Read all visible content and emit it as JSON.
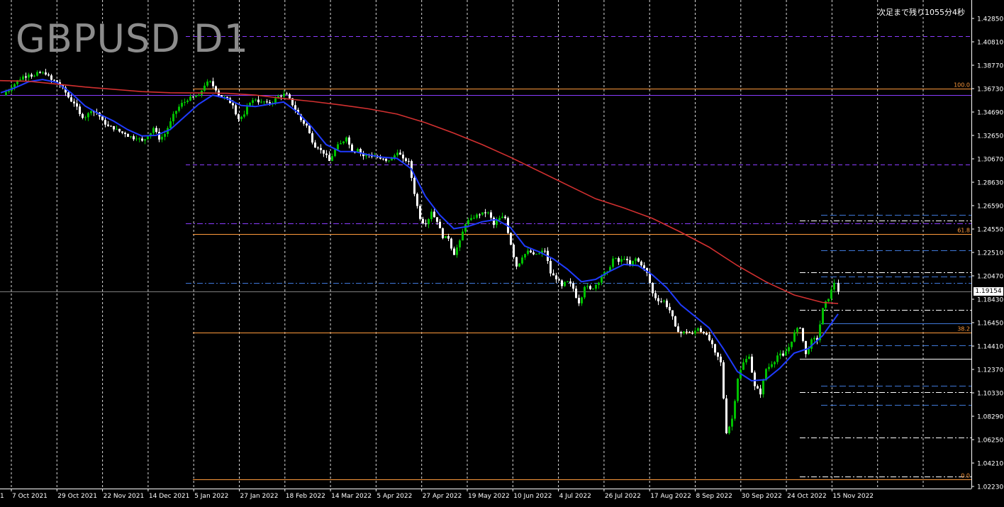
{
  "symbol_title": "GBPUSD D1",
  "countdown": "次足まで残り1055分4秒",
  "current_price_label": "1.19154",
  "colors": {
    "background": "#000000",
    "bull_candle": "#00c000",
    "bear_candle": "#ffffff",
    "ma_fast": "#1f3bff",
    "ma_slow": "#d23030",
    "fib_lines": "#ff9a3c",
    "purple_levels": "#8a3cff",
    "blue_levels": "#3f78d8",
    "grid": "#ffffff",
    "axis_text": "#ffffff"
  },
  "chart_data": {
    "type": "candlestick",
    "y_axis": {
      "range": [
        1.0182,
        1.4366
      ],
      "ticks": [
        "1.42850",
        "1.40810",
        "1.38770",
        "1.36730",
        "1.34690",
        "1.32650",
        "1.30670",
        "1.28630",
        "1.26590",
        "1.24550",
        "1.22510",
        "1.20470",
        "1.18430",
        "1.16450",
        "1.14410",
        "1.12370",
        "1.10330",
        "1.08290",
        "1.06250",
        "1.04210",
        "1.02230"
      ]
    },
    "x_axis": {
      "labels": [
        "7 Oct 2021",
        "29 Oct 2021",
        "22 Nov 2021",
        "14 Dec 2021",
        "5 Jan 2022",
        "27 Jan 2022",
        "18 Feb 2022",
        "14 Mar 2022",
        "5 Apr 2022",
        "27 Apr 2022",
        "19 May 2022",
        "10 Jun 2022",
        "4 Jul 2022",
        "26 Jul 2022",
        "17 Aug 2022",
        "8 Sep 2022",
        "30 Sep 2022",
        "24 Oct 2022",
        "15 Nov 2022"
      ],
      "first_partial_label": "1"
    },
    "series": [
      {
        "kind": "close",
        "points": [
          [
            1,
            1.3618
          ],
          [
            8,
            1.3648
          ],
          [
            16,
            1.3688
          ],
          [
            24,
            1.3748
          ],
          [
            32,
            1.3782
          ],
          [
            40,
            1.3798
          ],
          [
            48,
            1.3788
          ],
          [
            56,
            1.3812
          ],
          [
            64,
            1.3798
          ],
          [
            72,
            1.3752
          ],
          [
            80,
            1.3731
          ],
          [
            88,
            1.3685
          ],
          [
            96,
            1.36
          ],
          [
            104,
            1.3548
          ],
          [
            112,
            1.3455
          ],
          [
            120,
            1.3427
          ],
          [
            128,
            1.348
          ],
          [
            136,
            1.3468
          ],
          [
            144,
            1.3403
          ],
          [
            152,
            1.3352
          ],
          [
            160,
            1.3322
          ],
          [
            168,
            1.3304
          ],
          [
            176,
            1.3282
          ],
          [
            184,
            1.3262
          ],
          [
            192,
            1.3242
          ],
          [
            200,
            1.3224
          ],
          [
            208,
            1.3262
          ],
          [
            216,
            1.3334
          ],
          [
            224,
            1.3234
          ],
          [
            232,
            1.3282
          ],
          [
            240,
            1.3392
          ],
          [
            248,
            1.3482
          ],
          [
            256,
            1.3552
          ],
          [
            264,
            1.3572
          ],
          [
            272,
            1.3601
          ],
          [
            280,
            1.3622
          ],
          [
            288,
            1.3702
          ],
          [
            296,
            1.374
          ],
          [
            304,
            1.366
          ],
          [
            312,
            1.3598
          ],
          [
            320,
            1.3591
          ],
          [
            328,
            1.3531
          ],
          [
            336,
            1.3412
          ],
          [
            344,
            1.3452
          ],
          [
            352,
            1.3552
          ],
          [
            360,
            1.358
          ],
          [
            368,
            1.3562
          ],
          [
            376,
            1.3558
          ],
          [
            384,
            1.3552
          ],
          [
            392,
            1.3612
          ],
          [
            400,
            1.3632
          ],
          [
            408,
            1.3592
          ],
          [
            416,
            1.3492
          ],
          [
            424,
            1.3402
          ],
          [
            432,
            1.3356
          ],
          [
            440,
            1.3208
          ],
          [
            448,
            1.316
          ],
          [
            456,
            1.3112
          ],
          [
            464,
            1.3048
          ],
          [
            472,
            1.3148
          ],
          [
            480,
            1.3202
          ],
          [
            488,
            1.3252
          ],
          [
            496,
            1.3126
          ],
          [
            504,
            1.3152
          ],
          [
            512,
            1.309
          ],
          [
            520,
            1.3102
          ],
          [
            528,
            1.3089
          ],
          [
            536,
            1.3068
          ],
          [
            544,
            1.3049
          ],
          [
            552,
            1.3073
          ],
          [
            560,
            1.312
          ],
          [
            568,
            1.307
          ],
          [
            576,
            1.3047
          ],
          [
            584,
            1.2762
          ],
          [
            592,
            1.2545
          ],
          [
            600,
            1.2499
          ],
          [
            608,
            1.2608
          ],
          [
            616,
            1.252
          ],
          [
            624,
            1.2378
          ],
          [
            632,
            1.2374
          ],
          [
            640,
            1.2232
          ],
          [
            648,
            1.2358
          ],
          [
            656,
            1.2498
          ],
          [
            664,
            1.2552
          ],
          [
            672,
            1.2583
          ],
          [
            680,
            1.2602
          ],
          [
            688,
            1.2602
          ],
          [
            696,
            1.2493
          ],
          [
            704,
            1.2553
          ],
          [
            712,
            1.2553
          ],
          [
            720,
            1.2321
          ],
          [
            728,
            1.2132
          ],
          [
            736,
            1.221
          ],
          [
            744,
            1.227
          ],
          [
            752,
            1.2238
          ],
          [
            760,
            1.2246
          ],
          [
            768,
            1.2268
          ],
          [
            776,
            1.2072
          ],
          [
            784,
            1.2021
          ],
          [
            792,
            1.1962
          ],
          [
            800,
            1.2002
          ],
          [
            808,
            1.194
          ],
          [
            816,
            1.1812
          ],
          [
            824,
            1.1955
          ],
          [
            832,
            1.1937
          ],
          [
            840,
            1.1972
          ],
          [
            848,
            1.2051
          ],
          [
            856,
            1.209
          ],
          [
            864,
            1.2201
          ],
          [
            872,
            1.2173
          ],
          [
            880,
            1.2198
          ],
          [
            888,
            1.214
          ],
          [
            896,
            1.2202
          ],
          [
            904,
            1.2142
          ],
          [
            912,
            1.2078
          ],
          [
            920,
            1.19
          ],
          [
            928,
            1.183
          ],
          [
            936,
            1.1836
          ],
          [
            944,
            1.1752
          ],
          [
            952,
            1.1612
          ],
          [
            960,
            1.1552
          ],
          [
            968,
            1.1562
          ],
          [
            976,
            1.155
          ],
          [
            984,
            1.1596
          ],
          [
            992,
            1.1552
          ],
          [
            1000,
            1.1492
          ],
          [
            1008,
            1.1385
          ],
          [
            1016,
            1.13
          ],
          [
            1024,
            1.0685
          ],
          [
            1032,
            1.0811
          ],
          [
            1040,
            1.1158
          ],
          [
            1048,
            1.13
          ],
          [
            1056,
            1.135
          ],
          [
            1064,
            1.1093
          ],
          [
            1072,
            1.1022
          ],
          [
            1080,
            1.1242
          ],
          [
            1088,
            1.1284
          ],
          [
            1096,
            1.136
          ],
          [
            1104,
            1.1358
          ],
          [
            1112,
            1.1432
          ],
          [
            1120,
            1.1562
          ],
          [
            1128,
            1.1598
          ],
          [
            1136,
            1.1372
          ],
          [
            1144,
            1.15
          ],
          [
            1152,
            1.1492
          ],
          [
            1160,
            1.1772
          ],
          [
            1168,
            1.1852
          ],
          [
            1176,
            1.199
          ],
          [
            1182,
            1.1915
          ]
        ]
      },
      {
        "name": "",
        "kind": "moving-average-fast",
        "points": [
          [
            1,
            1.364
          ],
          [
            20,
            1.368
          ],
          [
            40,
            1.3735
          ],
          [
            60,
            1.3755
          ],
          [
            80,
            1.373
          ],
          [
            100,
            1.364
          ],
          [
            120,
            1.3525
          ],
          [
            140,
            1.3455
          ],
          [
            160,
            1.3395
          ],
          [
            180,
            1.332
          ],
          [
            200,
            1.3265
          ],
          [
            220,
            1.327
          ],
          [
            240,
            1.332
          ],
          [
            260,
            1.343
          ],
          [
            280,
            1.354
          ],
          [
            300,
            1.362
          ],
          [
            320,
            1.359
          ],
          [
            340,
            1.353
          ],
          [
            360,
            1.352
          ],
          [
            380,
            1.354
          ],
          [
            400,
            1.356
          ],
          [
            420,
            1.347
          ],
          [
            440,
            1.334
          ],
          [
            460,
            1.319
          ],
          [
            480,
            1.313
          ],
          [
            500,
            1.313
          ],
          [
            520,
            1.31
          ],
          [
            540,
            1.308
          ],
          [
            560,
            1.307
          ],
          [
            580,
            1.298
          ],
          [
            600,
            1.274
          ],
          [
            620,
            1.258
          ],
          [
            640,
            1.246
          ],
          [
            660,
            1.248
          ],
          [
            680,
            1.252
          ],
          [
            700,
            1.254
          ],
          [
            720,
            1.247
          ],
          [
            740,
            1.231
          ],
          [
            760,
            1.226
          ],
          [
            780,
            1.22
          ],
          [
            800,
            1.211
          ],
          [
            820,
            1.2
          ],
          [
            840,
            1.202
          ],
          [
            860,
            1.209
          ],
          [
            880,
            1.215
          ],
          [
            900,
            1.214
          ],
          [
            920,
            1.206
          ],
          [
            940,
            1.195
          ],
          [
            960,
            1.18
          ],
          [
            980,
            1.17
          ],
          [
            1000,
            1.16
          ],
          [
            1020,
            1.142
          ],
          [
            1040,
            1.122
          ],
          [
            1060,
            1.114
          ],
          [
            1080,
            1.115
          ],
          [
            1100,
            1.125
          ],
          [
            1120,
            1.138
          ],
          [
            1140,
            1.142
          ],
          [
            1160,
            1.153
          ],
          [
            1182,
            1.172
          ]
        ]
      },
      {
        "name": "",
        "kind": "moving-average-slow",
        "points": [
          [
            0,
            1.3745
          ],
          [
            40,
            1.374
          ],
          [
            80,
            1.3715
          ],
          [
            120,
            1.369
          ],
          [
            160,
            1.367
          ],
          [
            200,
            1.365
          ],
          [
            240,
            1.364
          ],
          [
            280,
            1.3638
          ],
          [
            320,
            1.3635
          ],
          [
            360,
            1.362
          ],
          [
            400,
            1.359
          ],
          [
            440,
            1.3565
          ],
          [
            480,
            1.3535
          ],
          [
            520,
            1.35
          ],
          [
            560,
            1.3455
          ],
          [
            600,
            1.338
          ],
          [
            640,
            1.329
          ],
          [
            680,
            1.319
          ],
          [
            720,
            1.308
          ],
          [
            760,
            1.296
          ],
          [
            800,
            1.284
          ],
          [
            840,
            1.272
          ],
          [
            880,
            1.264
          ],
          [
            920,
            1.255
          ],
          [
            960,
            1.243
          ],
          [
            1000,
            1.23
          ],
          [
            1040,
            1.214
          ],
          [
            1080,
            1.2
          ],
          [
            1120,
            1.1885
          ],
          [
            1160,
            1.182
          ],
          [
            1182,
            1.181
          ]
        ]
      }
    ],
    "horizontal_levels": [
      {
        "kind": "fib",
        "label": "100.0",
        "price": 1.3673
      },
      {
        "kind": "fib",
        "label": "61.8",
        "price": 1.2411
      },
      {
        "kind": "fib",
        "label": "38.2",
        "price": 1.1561
      },
      {
        "kind": "fib",
        "label": "0.0",
        "price": 1.0286
      },
      {
        "kind": "purple-dash",
        "price": 1.4132
      },
      {
        "kind": "purple-solid",
        "price": 1.3623
      },
      {
        "kind": "purple-dash",
        "price": 1.3017
      },
      {
        "kind": "purple-dashdot",
        "price": 1.2506
      },
      {
        "kind": "blue-dashdot",
        "price": 1.199
      },
      {
        "kind": "current-price",
        "price": 1.1915
      }
    ],
    "short_levels": [
      {
        "style": "blue-dash",
        "price": 1.258
      },
      {
        "style": "white-dashdot",
        "price": 1.253
      },
      {
        "style": "blue-dash",
        "price": 1.2275
      },
      {
        "style": "white-dashdot",
        "price": 1.208
      },
      {
        "style": "blue-dash",
        "price": 1.2045
      },
      {
        "style": "white-dashdot",
        "price": 1.1755
      },
      {
        "style": "blue-solid",
        "price": 1.164
      },
      {
        "style": "blue-dash",
        "price": 1.1447
      },
      {
        "style": "white-solid",
        "price": 1.133
      },
      {
        "style": "blue-dash",
        "price": 1.1095
      },
      {
        "style": "white-dashdot",
        "price": 1.104
      },
      {
        "style": "blue-dash",
        "price": 1.093
      },
      {
        "style": "white-dashdot",
        "price": 1.0645
      },
      {
        "style": "white-dashdot",
        "price": 1.031
      }
    ]
  }
}
